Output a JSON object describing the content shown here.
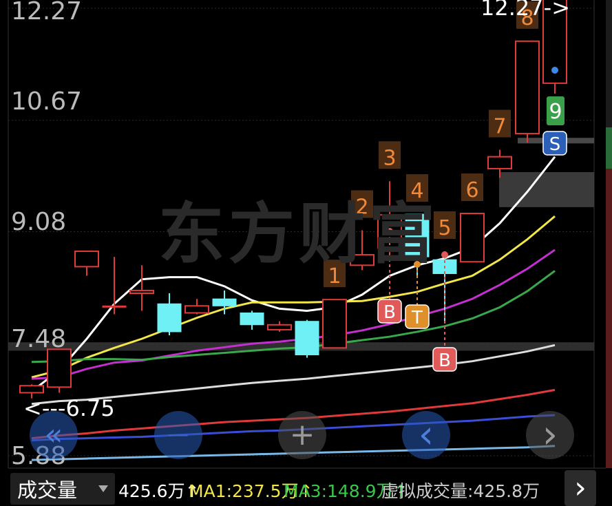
{
  "chart_data": {
    "type": "candlestick",
    "price_labels": [
      "12.27",
      "10.67",
      "9.08",
      "7.48",
      "5.88"
    ],
    "y_range": [
      5.8,
      12.5
    ],
    "candles": [
      {
        "o": 6.78,
        "c": 6.88,
        "h": 6.9,
        "l": 6.7
      },
      {
        "o": 6.86,
        "c": 7.4,
        "h": 7.4,
        "l": 6.78
      },
      {
        "o": 8.58,
        "c": 8.8,
        "h": 8.8,
        "l": 8.45
      },
      {
        "o": 8.02,
        "c": 8.02,
        "h": 8.72,
        "l": 7.9
      },
      {
        "o": 8.2,
        "c": 8.24,
        "h": 8.6,
        "l": 7.95
      },
      {
        "o": 8.05,
        "c": 7.65,
        "h": 8.2,
        "l": 7.6
      },
      {
        "o": 7.92,
        "c": 8.02,
        "h": 8.12,
        "l": 7.9
      },
      {
        "o": 8.12,
        "c": 8.02,
        "h": 8.24,
        "l": 7.9
      },
      {
        "o": 7.92,
        "c": 7.75,
        "h": 7.95,
        "l": 7.68
      },
      {
        "o": 7.68,
        "c": 7.75,
        "h": 7.8,
        "l": 7.65
      },
      {
        "o": 7.8,
        "c": 7.32,
        "h": 7.82,
        "l": 7.28
      },
      {
        "o": 7.42,
        "c": 8.11,
        "h": 8.11,
        "l": 7.42
      },
      {
        "o": 8.6,
        "c": 8.75,
        "h": 9.1,
        "l": 8.53
      },
      {
        "o": 8.85,
        "c": 9.32,
        "h": 9.8,
        "l": 8.7
      },
      {
        "o": 9.33,
        "c": 8.72,
        "h": 9.33,
        "l": 8.45
      },
      {
        "o": 8.68,
        "c": 8.48,
        "h": 8.8,
        "l": 7.8
      },
      {
        "o": 8.65,
        "c": 9.34,
        "h": 9.34,
        "l": 8.65
      },
      {
        "o": 9.98,
        "c": 10.15,
        "h": 10.25,
        "l": 9.85
      },
      {
        "o": 10.48,
        "c": 11.8,
        "h": 11.8,
        "l": 10.35
      },
      {
        "o": 11.2,
        "c": 12.5,
        "h": 12.5,
        "l": 11.05
      }
    ],
    "count_labels": [
      {
        "text": "1",
        "candle": 11
      },
      {
        "text": "2",
        "candle": 12
      },
      {
        "text": "3",
        "candle": 13
      },
      {
        "text": "4",
        "candle": 14
      },
      {
        "text": "5",
        "candle": 15
      },
      {
        "text": "6",
        "candle": 16
      },
      {
        "text": "7",
        "candle": 17
      },
      {
        "text": "8",
        "candle": 18
      }
    ],
    "count_9": "9",
    "signals": [
      {
        "text": "B",
        "candle": 13,
        "color": "#e05a5a"
      },
      {
        "text": "T",
        "candle": 14,
        "color": "#e0902a"
      },
      {
        "text": "B",
        "candle": 15,
        "color": "#e05a5a"
      },
      {
        "text": "S",
        "candle": 19,
        "color": "#2c5fb8"
      }
    ],
    "min_marker": "<---6.75",
    "max_marker": "12.27->",
    "ma_lines": [
      {
        "color": "#ffffff",
        "values": [
          6.8,
          7.1,
          7.55,
          8.05,
          8.4,
          8.43,
          8.43,
          8.3,
          8.1,
          7.98,
          7.95,
          8.0,
          8.18,
          8.45,
          8.6,
          8.7,
          8.85,
          9.2,
          9.65,
          10.15
        ]
      },
      {
        "color": "#f2e64a",
        "values": [
          7.0,
          7.1,
          7.28,
          7.42,
          7.55,
          7.7,
          7.85,
          7.98,
          8.07,
          8.07,
          8.07,
          8.08,
          8.09,
          8.15,
          8.22,
          8.34,
          8.45,
          8.68,
          8.97,
          9.3
        ]
      },
      {
        "color": "#c42fcf",
        "values": [
          6.98,
          7.0,
          7.12,
          7.21,
          7.24,
          7.31,
          7.38,
          7.43,
          7.48,
          7.51,
          7.55,
          7.6,
          7.67,
          7.76,
          7.87,
          7.98,
          8.12,
          8.32,
          8.55,
          8.82
        ]
      },
      {
        "color": "#3aa84a",
        "values": [
          7.22,
          7.23,
          7.26,
          7.26,
          7.25,
          7.29,
          7.32,
          7.35,
          7.38,
          7.41,
          7.43,
          7.48,
          7.53,
          7.58,
          7.65,
          7.73,
          7.84,
          8.0,
          8.23,
          8.52
        ]
      },
      {
        "color": "#dddddd",
        "values": [
          6.62,
          6.66,
          6.68,
          6.72,
          6.76,
          6.8,
          6.84,
          6.88,
          6.92,
          6.95,
          6.98,
          7.02,
          7.06,
          7.1,
          7.14,
          7.18,
          7.23,
          7.3,
          7.37,
          7.46
        ]
      },
      {
        "color": "#e03a3a",
        "values": [
          6.13,
          6.17,
          6.2,
          6.24,
          6.27,
          6.3,
          6.33,
          6.36,
          6.38,
          6.4,
          6.42,
          6.45,
          6.48,
          6.51,
          6.55,
          6.59,
          6.63,
          6.69,
          6.75,
          6.82
        ]
      },
      {
        "color": "#3a4ed8",
        "values": [
          6.1,
          6.12,
          6.13,
          6.14,
          6.15,
          6.17,
          6.19,
          6.21,
          6.23,
          6.24,
          6.26,
          6.28,
          6.3,
          6.32,
          6.34,
          6.36,
          6.38,
          6.41,
          6.44,
          6.46
        ]
      },
      {
        "color": "#7ab8e8",
        "values": [
          5.82,
          5.83,
          5.84,
          5.85,
          5.86,
          5.87,
          5.88,
          5.89,
          5.9,
          5.91,
          5.92,
          5.93,
          5.94,
          5.95,
          5.96,
          5.97,
          5.98,
          5.99,
          6.0,
          6.02
        ]
      }
    ],
    "colors": {
      "up": "#e03a3a",
      "down": "#6ff0f5",
      "count": "#f08a3a"
    }
  },
  "watermark": "东方财富",
  "controls": [
    {
      "icon": "double-chevron-left-icon",
      "glyph": "«"
    },
    {
      "icon": "minus-icon",
      "glyph": "—"
    },
    {
      "icon": "plus-icon",
      "glyph": "+"
    },
    {
      "icon": "chevron-left-icon",
      "glyph": "‹"
    },
    {
      "icon": "chevron-right-icon",
      "glyph": "›"
    }
  ],
  "indicator": {
    "name": "成交量",
    "vol": "425.6万↑",
    "ma1": "MA1:237.5万↑",
    "ma3": "MA3:148.9万↑",
    "virtual": "虚拟成交量:425.8万",
    "vol_color": "#ffffff",
    "ma1_color": "#f2e64a",
    "ma3_color": "#3ac84a",
    "virtual_color": "#cccccc"
  },
  "next_glyph": "›"
}
